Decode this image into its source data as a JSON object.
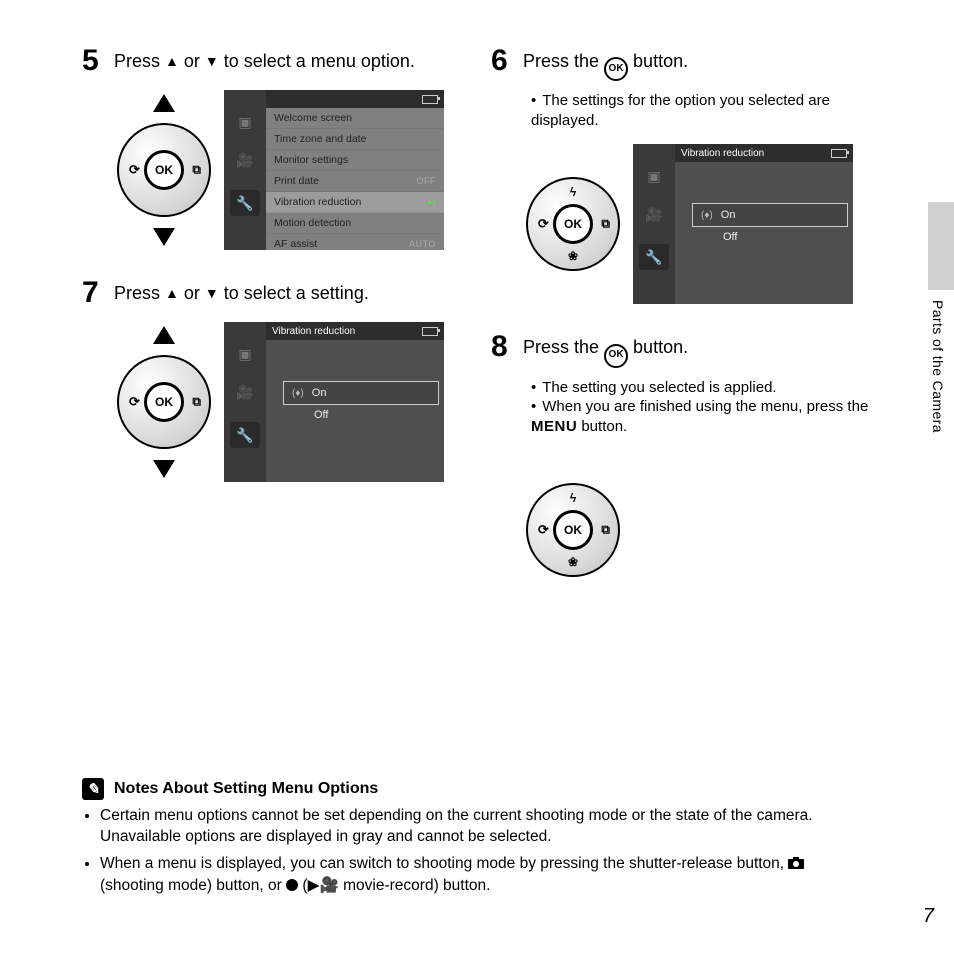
{
  "section_label": "Parts of the Camera",
  "page_number": "7",
  "ok_label": "OK",
  "menu_word": "MENU",
  "steps": {
    "s5": {
      "num": "5",
      "text_a": "Press ",
      "text_b": " or ",
      "text_c": " to select a menu option."
    },
    "s6": {
      "num": "6",
      "text_a": "Press the ",
      "text_b": " button.",
      "bullets": [
        "The settings for the option you selected are displayed."
      ]
    },
    "s7": {
      "num": "7",
      "text_a": "Press ",
      "text_b": " or ",
      "text_c": " to select a setting."
    },
    "s8": {
      "num": "8",
      "text_a": "Press the ",
      "text_b": " button.",
      "bullets": [
        "The setting you selected is applied.",
        "When you are finished using the menu, press the "
      ],
      "bullet2_suffix": " button."
    }
  },
  "screen5": {
    "header": "",
    "rows": [
      {
        "label": "Welcome screen",
        "val": ""
      },
      {
        "label": "Time zone and date",
        "val": ""
      },
      {
        "label": "Monitor settings",
        "val": ""
      },
      {
        "label": "Print date",
        "val": "OFF"
      },
      {
        "label": "Vibration reduction",
        "val": "(♦)",
        "sel": true
      },
      {
        "label": "Motion detection",
        "val": ""
      },
      {
        "label": "AF assist",
        "val": "AUTO"
      }
    ]
  },
  "screen6": {
    "header": "Vibration reduction",
    "options": [
      {
        "label": "On",
        "sel": true,
        "icon": true
      },
      {
        "label": "Off"
      }
    ]
  },
  "screen7": {
    "header": "Vibration reduction",
    "options": [
      {
        "label": "On",
        "sel": true,
        "icon": true
      },
      {
        "label": "Off"
      }
    ]
  },
  "notes": {
    "title": "Notes About Setting Menu Options",
    "items": [
      "Certain menu options cannot be set depending on the current shooting mode or the state of the camera. Unavailable options are displayed in gray and cannot be selected.",
      "When a menu is displayed, you can switch to shooting mode by pressing the shutter-release button, "
    ],
    "item2_mid1": " (shooting mode) button, or ",
    "item2_mid2": " (",
    "item2_mid3": " movie-record) button."
  }
}
